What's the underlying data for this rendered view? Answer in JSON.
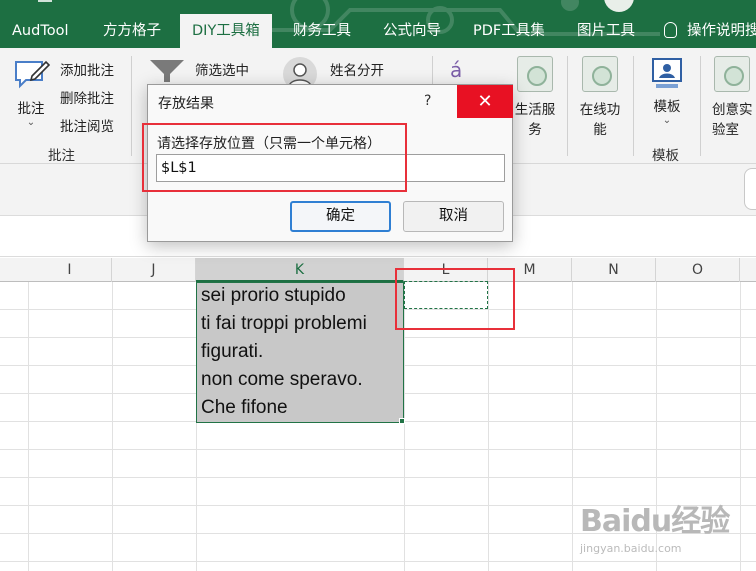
{
  "tabs": [
    "AudTool",
    "方方格子",
    "DIY工具箱",
    "财务工具",
    "公式向导",
    "PDF工具集",
    "图片工具",
    "操作说明搜索"
  ],
  "active_tab": "DIY工具箱",
  "ribbon": {
    "comment_big": "批注",
    "comment_items": [
      "添加批注",
      "删除批注",
      "批注阅览"
    ],
    "comment_group": "批注",
    "filter_item": "筛选选中",
    "name_split": "姓名分开",
    "life_service": [
      "生活服",
      "务"
    ],
    "online": [
      "在线功",
      "能"
    ],
    "template": "模板",
    "template_group": "模板",
    "creative": [
      "创意实",
      "验室"
    ]
  },
  "columns": [
    "I",
    "J",
    "K",
    "L",
    "M",
    "N",
    "O"
  ],
  "selected_column": "K",
  "cells_k": [
    "sei prorio stupido",
    "ti fai troppi problemi",
    "figurati.",
    "non come speravo.",
    "Che fifone"
  ],
  "dialog": {
    "title": "存放结果",
    "help": "?",
    "close": "✕",
    "prompt": "请选择存放位置（只需一个单元格）",
    "input_value": "$L$1",
    "ok": "确定",
    "cancel": "取消"
  },
  "watermark": {
    "main": "Baidu经验",
    "url": "jingyan.baidu.com"
  }
}
